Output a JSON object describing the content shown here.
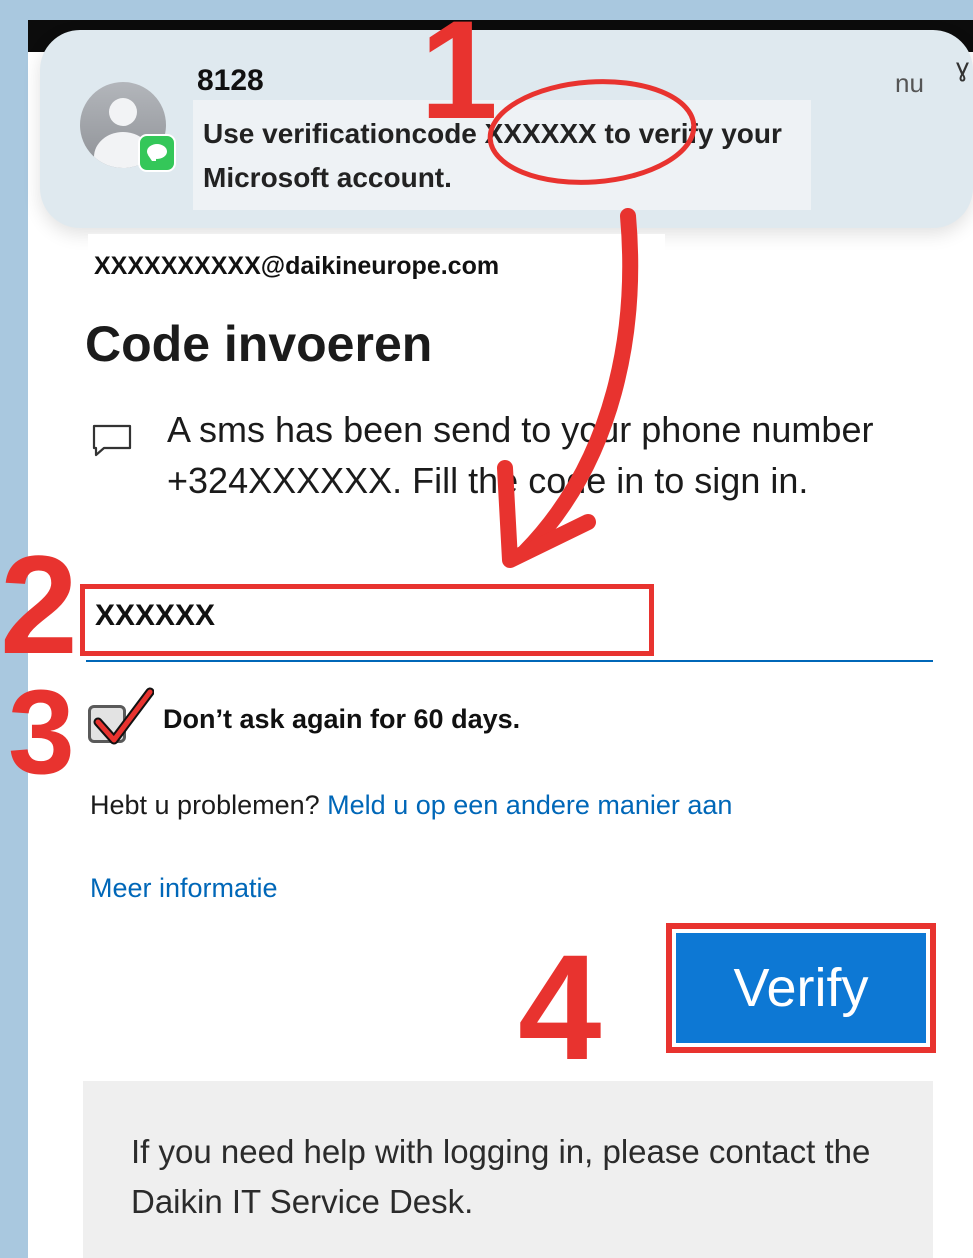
{
  "notification": {
    "sender": "8128",
    "time": "nu",
    "message": "Use verificationcode XXXXXX to verify your Microsoft account."
  },
  "account": {
    "email": "XXXXXXXXXX@daikineurope.com"
  },
  "page": {
    "title": "Code invoeren",
    "sms_info": "A sms has been send to your phone number +324XXXXXX. Fill the code in to sign in."
  },
  "code_input": {
    "value": "XXXXXX"
  },
  "remember": {
    "label": "Don’t ask again for 60 days.",
    "checked": true
  },
  "problems": {
    "prefix": "Hebt u problemen?",
    "link": "Meld u op een andere manier aan"
  },
  "more_info": "Meer informatie",
  "verify_button": "Verify",
  "help_text": "If you need help with logging in, please contact the Daikin IT Service Desk.",
  "annotations": {
    "steps": [
      "1",
      "2",
      "3",
      "4"
    ],
    "color": "#e8332f"
  },
  "colors": {
    "link": "#0067b8",
    "button": "#0d78d4",
    "background": "#a9c8df"
  }
}
